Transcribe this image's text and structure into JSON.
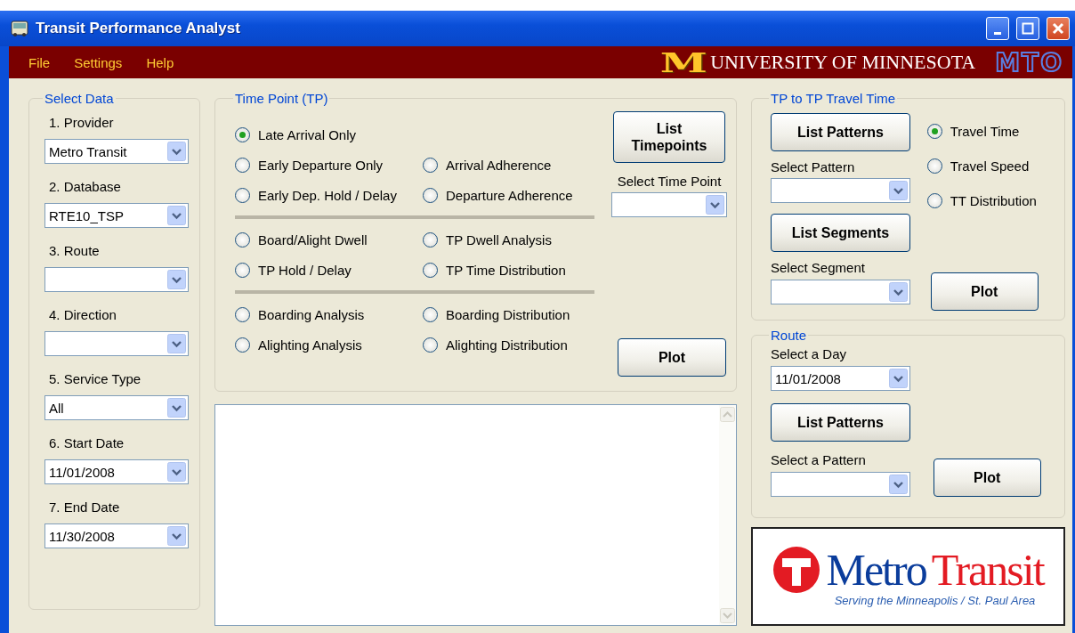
{
  "window": {
    "title": "Transit Performance Analyst"
  },
  "menu": [
    {
      "label": "File"
    },
    {
      "label": "Settings"
    },
    {
      "label": "Help"
    }
  ],
  "banner": {
    "mark": "M",
    "university": "UNIVERSITY OF MINNESOTA",
    "center": "MTO"
  },
  "select_data": {
    "title": "Select Data",
    "fields": [
      {
        "label": "1. Provider",
        "value": "Metro Transit"
      },
      {
        "label": "2. Database",
        "value": "RTE10_TSP"
      },
      {
        "label": "3. Route"
      },
      {
        "label": "4. Direction"
      },
      {
        "label": "5. Service Type",
        "value": "All"
      },
      {
        "label": "6. Start Date",
        "value": "11/01/2008"
      },
      {
        "label": "7. End Date",
        "value": "11/30/2008"
      }
    ]
  },
  "time_point": {
    "title": "Time Point (TP)",
    "sections": [
      {
        "rows": [
          {
            "left": {
              "label": "Late Arrival Only",
              "selected": true
            }
          },
          {
            "left": {
              "label": "Early Departure Only",
              "selected": false
            },
            "right": {
              "label": "Arrival Adherence",
              "selected": false
            }
          },
          {
            "left": {
              "label": "Early Dep. Hold / Delay",
              "selected": false
            },
            "right": {
              "label": "Departure Adherence",
              "selected": false
            }
          }
        ]
      },
      {
        "rows": [
          {
            "left": {
              "label": "Board/Alight Dwell",
              "selected": false
            },
            "right": {
              "label": "TP Dwell Analysis",
              "selected": false
            }
          },
          {
            "left": {
              "label": "TP Hold / Delay",
              "selected": false
            },
            "right": {
              "label": "TP Time Distribution",
              "selected": false
            }
          }
        ]
      },
      {
        "rows": [
          {
            "left": {
              "label": "Boarding Analysis",
              "selected": false
            },
            "right": {
              "label": "Boarding Distribution",
              "selected": false
            }
          },
          {
            "left": {
              "label": "Alighting Analysis",
              "selected": false
            },
            "right": {
              "label": "Alighting Distribution",
              "selected": false
            }
          }
        ]
      }
    ],
    "list_button": "List Timepoints",
    "select_label": "Select Time Point",
    "plot_button": "Plot"
  },
  "tp_travel": {
    "title": "TP to TP Travel Time",
    "list_patterns": "List Patterns",
    "pattern_label": "Select Pattern",
    "list_segments": "List Segments",
    "segment_label": "Select Segment",
    "modes": [
      {
        "label": "Travel Time",
        "selected": true
      },
      {
        "label": "Travel Speed",
        "selected": false
      },
      {
        "label": "TT Distribution",
        "selected": false
      }
    ],
    "plot_button": "Plot"
  },
  "route": {
    "title": "Route",
    "day_label": "Select a Day",
    "day_value": "11/01/2008",
    "list_patterns": "List Patterns",
    "pattern_label": "Select a Pattern",
    "plot_button": "Plot"
  },
  "logo": {
    "first": "Metro",
    "second": "Transit",
    "tagline": "Serving the Minneapolis / St. Paul Area"
  }
}
